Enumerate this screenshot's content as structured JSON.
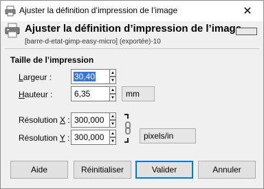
{
  "window": {
    "title": "Ajuster la définition d’impression de l’image",
    "close_glyph": "✕"
  },
  "header": {
    "title": "Ajuster la définition d’impression de l’image",
    "subtitle": "[barre-d-etat-gimp-easy-micro] (exportée)-10"
  },
  "section": {
    "title": "Taille de l’impression"
  },
  "fields": {
    "width_label_u": "L",
    "width_label_rest": "argeur :",
    "width_value": "30,40",
    "height_label_u": "H",
    "height_label_rest": "auteur :",
    "height_value": "6,35",
    "size_unit": "mm",
    "resx_label_pre": "Résolution ",
    "resx_label_u": "X",
    "resx_label_post": " :",
    "resx_value": "300,000",
    "resy_label_pre": "Résolution ",
    "resy_label_u": "Y",
    "resy_label_post": " :",
    "resy_value": "300,000",
    "res_unit": "pixels/in"
  },
  "buttons": {
    "help": "Aide",
    "reset": "Réinitialiser",
    "ok": "Valider",
    "cancel": "Annuler"
  },
  "colors": {
    "accent": "#0078d7",
    "selection": "#3875d7"
  },
  "icons": [
    "gimp-printer-icon",
    "printer-icon",
    "chain-link-icon",
    "close-icon",
    "spin-up-icon",
    "spin-down-icon"
  ]
}
